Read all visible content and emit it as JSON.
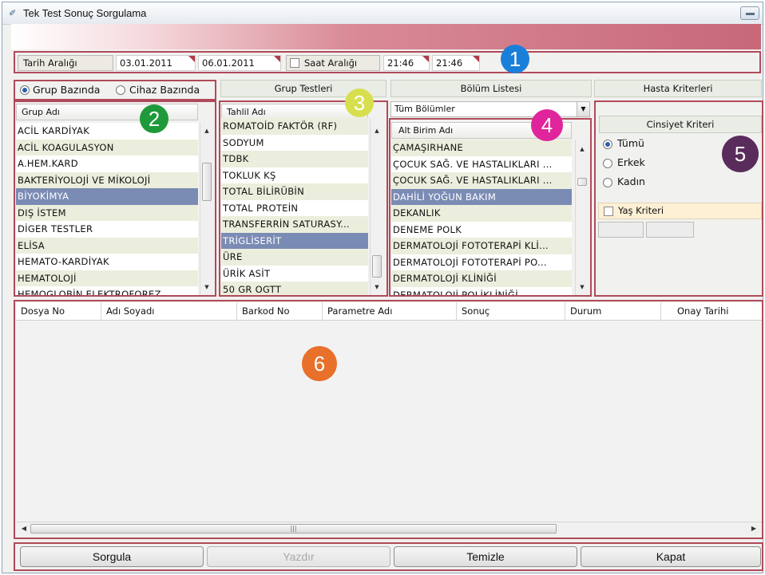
{
  "window": {
    "title": "Tek Test Sonuç Sorgulama",
    "icon": "app-icon"
  },
  "date_filter": {
    "date_range_label": "Tarih Aralığı",
    "date_from": "03.01.2011",
    "date_to": "06.01.2011",
    "time_range_label": "Saat Aralığı",
    "time_range_checked": false,
    "time_from": "21:46",
    "time_to": "21:46"
  },
  "mode": {
    "group_based_label": "Grup Bazında",
    "device_based_label": "Cihaz Bazında",
    "selected": "Grup Bazında"
  },
  "groups": {
    "header": "Grup Adı",
    "items": [
      "ACİL KARDİYAK",
      "ACİL KOAGULASYON",
      "A.HEM.KARD",
      "BAKTERİYOLOJİ VE MİKOLOJİ",
      "BİYOKİMYA",
      "DIŞ İSTEM",
      "DİGER TESTLER",
      "ELİSA",
      "HEMATO-KARDİYAK",
      "HEMATOLOJİ",
      "HEMOGLOBİN ELEKTROFOREZ"
    ],
    "selected_index": 4
  },
  "group_tests": {
    "section_title": "Grup Testleri",
    "header": "Tahlil Adı",
    "items": [
      "ROMATOİD FAKTÖR (RF)",
      "SODYUM",
      "TDBK",
      "TOKLUK KŞ",
      "TOTAL BİLİRÜBİN",
      "TOTAL PROTEİN",
      "TRANSFERRİN SATURASY...",
      "TRİGLİSERİT",
      "ÜRE",
      "ÜRİK ASİT",
      "50 GR OGTT"
    ],
    "selected_index": 7
  },
  "departments": {
    "section_title": "Bölüm Listesi",
    "combo_value": "Tüm Bölümler",
    "header": "Alt Birim Adı",
    "items": [
      "ÇAMAŞIRHANE",
      "ÇOCUK SAĞ. VE HASTALIKLARI ...",
      "ÇOCUK SAĞ. VE HASTALIKLARI ...",
      "DAHİLİ YOĞUN BAKIM",
      "DEKANLIK",
      "DENEME POLK",
      "DERMATOLOJİ FOTOTERAPİ KLİ...",
      "DERMATOLOJİ FOTOTERAPİ PO...",
      "DERMATOLOJİ KLİNİĞİ",
      "DERMATOLOJİ POLİKLİNİĞİ"
    ],
    "selected_index": 3
  },
  "patient_criteria": {
    "section_title": "Hasta Kriterleri",
    "gender_title": "Cinsiyet Kriteri",
    "gender_options": [
      "Tümü",
      "Erkek",
      "Kadın"
    ],
    "gender_selected": "Tümü",
    "age_label": "Yaş Kriteri",
    "age_checked": false
  },
  "results_table": {
    "columns": [
      "Dosya No",
      "Adı Soyadı",
      "Barkod No",
      "Parametre Adı",
      "Sonuç",
      "Durum",
      "Onay Tarihi"
    ],
    "rows": []
  },
  "buttons": {
    "query": "Sorgula",
    "print": "Yazdır",
    "clear": "Temizle",
    "close": "Kapat"
  },
  "annotations": [
    "1",
    "2",
    "3",
    "4",
    "5",
    "6"
  ],
  "colors": {
    "badge_1": "#1a7fd9",
    "badge_2": "#1e9a3a",
    "badge_3": "#d8df4e",
    "badge_4": "#e0249b",
    "badge_5": "#5a2c5c",
    "badge_6": "#e8702a",
    "selection": "#7a8bb4",
    "frame_red": "#b04a5a"
  }
}
